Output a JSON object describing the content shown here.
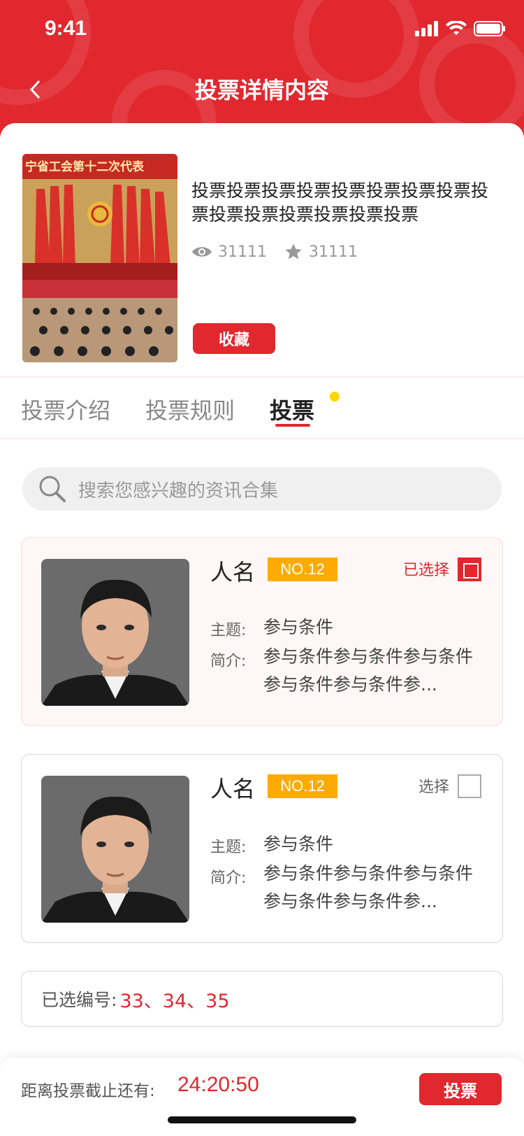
{
  "status": {
    "time": "9:41"
  },
  "header": {
    "title": "投票详情内容"
  },
  "info": {
    "title": "投票投票投票投票投票投票投票投票投票投票投票投票投票投票投票",
    "views": "31111",
    "stars": "31111",
    "collect_label": "收藏",
    "banner_text": "宁省工会第十二次代表"
  },
  "tabs": [
    {
      "label": "投票介绍"
    },
    {
      "label": "投票规则"
    },
    {
      "label": "投票"
    }
  ],
  "search": {
    "placeholder": "搜索您感兴趣的资讯合集"
  },
  "candidates": [
    {
      "name": "人名",
      "number": "NO.12",
      "select_label": "已选择",
      "topic_label": "主题:",
      "topic": "参与条件",
      "intro_label": "简介:",
      "intro": "参与条件参与条件参与条件参与条件参与条件参..."
    },
    {
      "name": "人名",
      "number": "NO.12",
      "select_label": "选择",
      "topic_label": "主题:",
      "topic": "参与条件",
      "intro_label": "简介:",
      "intro": "参与条件参与条件参与条件参与条件参与条件参..."
    }
  ],
  "chosen": {
    "label": "已选编号:",
    "value": "33、34、35"
  },
  "footer": {
    "deadline_label": "距离投票截止还有:",
    "deadline_value": "24:20:50",
    "vote_label": "投票"
  },
  "colors": {
    "brand_red": "#e0282e",
    "badge_orange": "#ffaa00",
    "dot_yellow": "#ffd400"
  }
}
